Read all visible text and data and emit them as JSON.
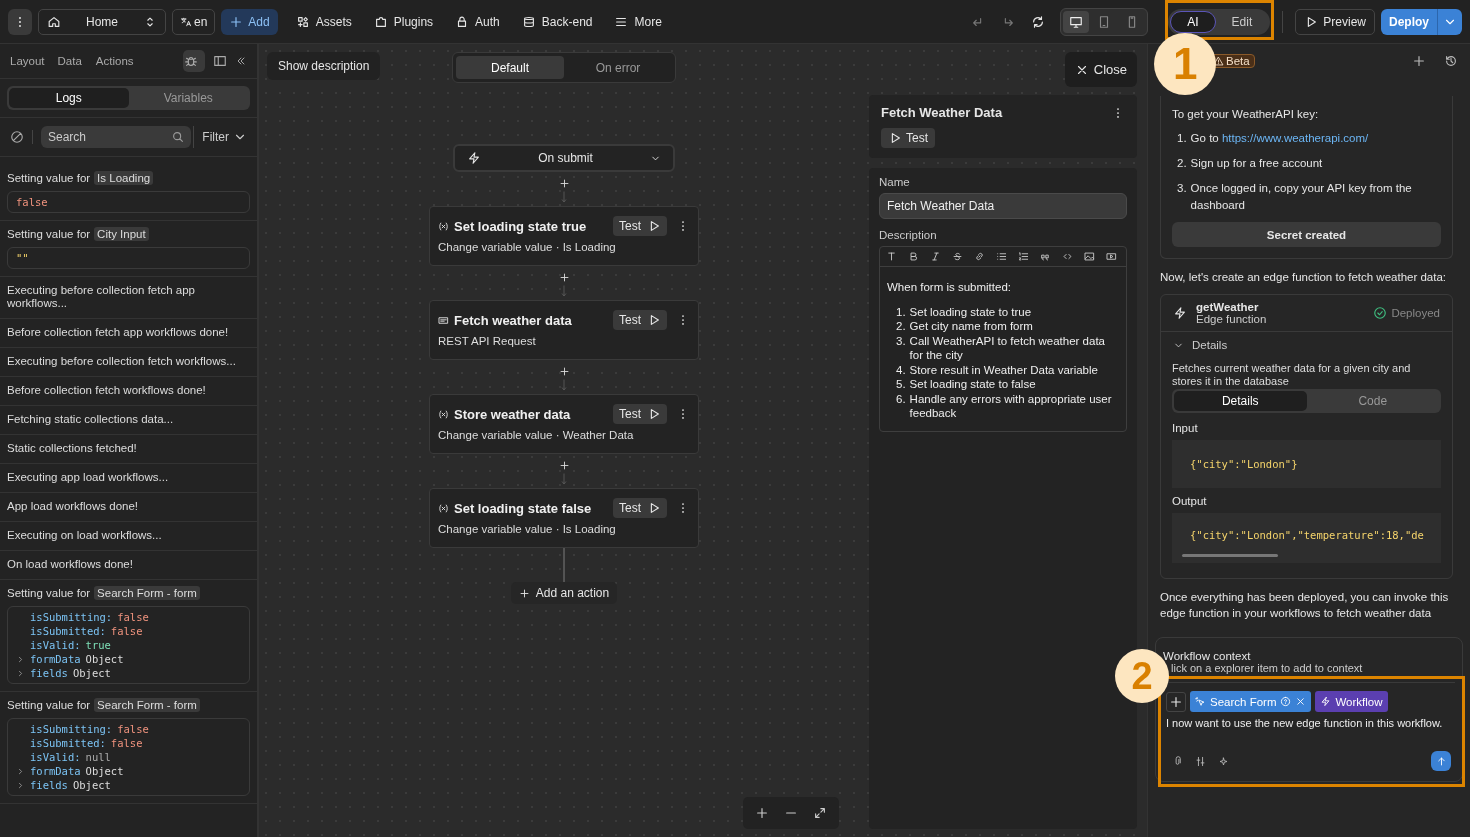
{
  "topbar": {
    "page": "Home",
    "lang": "en",
    "add": "Add",
    "nav": [
      "Assets",
      "Plugins",
      "Auth",
      "Back-end",
      "More"
    ],
    "devices": [
      {
        "selected": true
      },
      {
        "selected": false
      },
      {
        "selected": false
      }
    ],
    "modes": [
      {
        "label": "AI",
        "selected": true
      },
      {
        "label": "Edit",
        "selected": false
      }
    ],
    "preview": "Preview",
    "deploy": "Deploy"
  },
  "left": {
    "tabs": [
      "Layout",
      "Data",
      "Actions"
    ],
    "subtabs": [
      {
        "label": "Logs",
        "selected": true
      },
      {
        "label": "Variables",
        "selected": false
      }
    ],
    "search": {
      "placeholder": "Search"
    },
    "filter": "Filter",
    "logs": [
      {
        "kind": "value",
        "text": "Setting value for",
        "target": "Is Loading",
        "lines": [
          {
            "value": "false",
            "kind": "false"
          }
        ]
      },
      {
        "kind": "value",
        "text": "Setting value for",
        "target": "City Input",
        "lines": [
          {
            "value": "\"\"",
            "kind": "string"
          }
        ]
      },
      {
        "kind": "message",
        "text": "Executing before collection fetch app workflows..."
      },
      {
        "kind": "message",
        "text": "Before collection fetch app workflows done!"
      },
      {
        "kind": "message",
        "text": "Executing before collection fetch workflows..."
      },
      {
        "kind": "message",
        "text": "Before collection fetch workflows done!"
      },
      {
        "kind": "message",
        "text": "Fetching static collections data..."
      },
      {
        "kind": "message",
        "text": "Static collections fetched!"
      },
      {
        "kind": "message",
        "text": "Executing app load workflows..."
      },
      {
        "kind": "message",
        "text": "App load workflows done!"
      },
      {
        "kind": "message",
        "text": "Executing on load workflows..."
      },
      {
        "kind": "message",
        "text": "On load workflows done!"
      },
      {
        "kind": "value",
        "text": "Setting value for",
        "target": "Search Form - form",
        "lines": [
          {
            "key": "isSubmitting:",
            "value": "false",
            "kind": "false"
          },
          {
            "key": "isSubmitted:",
            "value": "false",
            "kind": "false"
          },
          {
            "key": "isValid:",
            "value": "true",
            "kind": "true"
          },
          {
            "key": "formData",
            "value": "Object",
            "kind": "object"
          },
          {
            "key": "fields",
            "value": "Object",
            "kind": "object"
          }
        ]
      },
      {
        "kind": "value",
        "text": "Setting value for",
        "target": "Search Form - form",
        "lines": [
          {
            "key": "isSubmitting:",
            "value": "false",
            "kind": "false"
          },
          {
            "key": "isSubmitted:",
            "value": "false",
            "kind": "false"
          },
          {
            "key": "isValid:",
            "value": "null",
            "kind": "null"
          },
          {
            "key": "formData",
            "value": "Object",
            "kind": "object"
          },
          {
            "key": "fields",
            "value": "Object",
            "kind": "object"
          }
        ]
      }
    ]
  },
  "canvas": {
    "show_description": "Show description",
    "modes": [
      {
        "label": "Default",
        "selected": true
      },
      {
        "label": "On error",
        "selected": false
      }
    ],
    "trigger": "On submit",
    "steps": [
      {
        "kind": "variable",
        "title": "Set loading state true",
        "subtitle": "Change variable value · Is Loading",
        "test": "Test"
      },
      {
        "kind": "api",
        "title": "Fetch weather data",
        "subtitle": "REST API Request",
        "test": "Test"
      },
      {
        "kind": "variable",
        "title": "Store weather data",
        "subtitle": "Change variable value · Weather Data",
        "test": "Test"
      },
      {
        "kind": "variable",
        "title": "Set loading state false",
        "subtitle": "Change variable value · Is Loading",
        "test": "Test"
      }
    ],
    "add_action": "Add an action"
  },
  "properties": {
    "close": "Close",
    "title": "Fetch Weather Data",
    "test": "Test",
    "name_label": "Name",
    "name": "Fetch Weather Data",
    "description_label": "Description",
    "intro": "When form is submitted:",
    "items": [
      {
        "n": "1.",
        "text": "Set loading state to true"
      },
      {
        "n": "2.",
        "text": "Get city name from form"
      },
      {
        "n": "3.",
        "text": "Call WeatherAPI to fetch weather data for the city"
      },
      {
        "n": "4.",
        "text": "Store result in Weather Data variable"
      },
      {
        "n": "5.",
        "text": "Set loading state to false"
      },
      {
        "n": "6.",
        "text": "Handle any errors with appropriate user feedback"
      }
    ]
  },
  "ai": {
    "badge": "Beta",
    "key_intro": "To get your WeatherAPI key:",
    "key_steps": [
      {
        "n": "1.",
        "text": "Go to ",
        "link": "https://www.weatherapi.com/"
      },
      {
        "n": "2.",
        "text": "Sign up for a free account"
      },
      {
        "n": "3.",
        "text": "Once logged in, copy your API key from the dashboard"
      }
    ],
    "secret_button": "Secret created",
    "lead": "Now, let's create an edge function to fetch weather data:",
    "function": {
      "name": "getWeather",
      "type": "Edge function",
      "status": "Deployed",
      "details_label": "Details",
      "expanded": true,
      "description": "Fetches current weather data for a given city and stores it in the database",
      "tabs": [
        {
          "label": "Details",
          "selected": true
        },
        {
          "label": "Code",
          "selected": false
        }
      ],
      "input_label": "Input",
      "input": "{\"city\":\"London\"}",
      "output_label": "Output",
      "output": "{\"city\":\"London\",\"temperature\":18,\"de"
    },
    "closing": "Once everything has been deployed, you can invoke this edge function in your workflows to fetch weather data",
    "context_title": "Workflow context",
    "context_hint": "lick on a explorer item to add to context",
    "chips": [
      {
        "label": "Search Form",
        "color": "#3b82d6",
        "removable": true
      },
      {
        "label": "Workflow",
        "color": "#5b3fb0",
        "removable": false
      }
    ],
    "message": "I now want to use the new edge function in this workflow."
  },
  "callouts": [
    "1",
    "2"
  ]
}
